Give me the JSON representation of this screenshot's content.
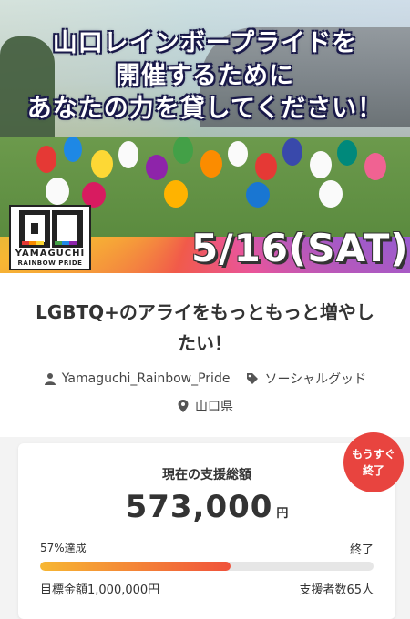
{
  "hero": {
    "banner_line1": "山口レインボープライドを",
    "banner_line2": "開催するために",
    "banner_line3": "あなたの力を貸してください！",
    "logo_line1": "YAMAGUCHI",
    "logo_line2": "RAINBOW PRIDE",
    "date": "5/16(SAT)"
  },
  "project": {
    "title": "LGBTQ+のアライをもっともっと増やしたい！",
    "owner": "Yamaguchi_Rainbow_Pride",
    "category": "ソーシャルグッド",
    "location": "山口県"
  },
  "funding": {
    "label": "現在の支援総額",
    "amount": "573,000",
    "unit": "円",
    "percent_text": "57%達成",
    "percent": 57,
    "status": "終了",
    "goal": "目標金額1,000,000円",
    "backers": "支援者数65人",
    "badge_line1": "もうすぐ",
    "badge_line2": "終了"
  },
  "colors": {
    "accent": "#e8443f",
    "bar_start": "#f7b733",
    "bar_end": "#f0523b"
  },
  "icons": [
    "user-icon",
    "tag-icon",
    "location-pin-icon"
  ]
}
